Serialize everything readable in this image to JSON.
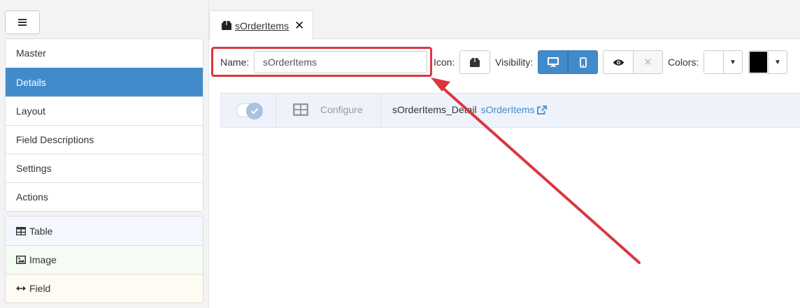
{
  "sidebar": {
    "menu_icon": "hamburger-icon",
    "nav_items": [
      {
        "label": "Master"
      },
      {
        "label": "Details",
        "active": true
      },
      {
        "label": "Layout"
      },
      {
        "label": "Field Descriptions"
      },
      {
        "label": "Settings"
      },
      {
        "label": "Actions"
      }
    ],
    "tools": [
      {
        "label": "Table",
        "icon": "table-icon"
      },
      {
        "label": "Image",
        "icon": "image-icon"
      },
      {
        "label": "Field",
        "icon": "arrows-horizontal-icon"
      }
    ]
  },
  "tab": {
    "label": "sOrderItems",
    "icon": "box-icon",
    "close_icon": "close-icon"
  },
  "toolbar": {
    "name_label": "Name:",
    "name_value": "sOrderItems",
    "icon_label": "Icon:",
    "visibility_label": "Visibility:",
    "colors_label": "Colors:",
    "color_primary": "#ffffff",
    "color_secondary": "#000000"
  },
  "detail": {
    "configure_label": "Configure",
    "name": "sOrderItems_Detail",
    "link_label": "sOrderItems"
  },
  "colors": {
    "accent": "#428bca",
    "highlight": "#d9373f"
  }
}
